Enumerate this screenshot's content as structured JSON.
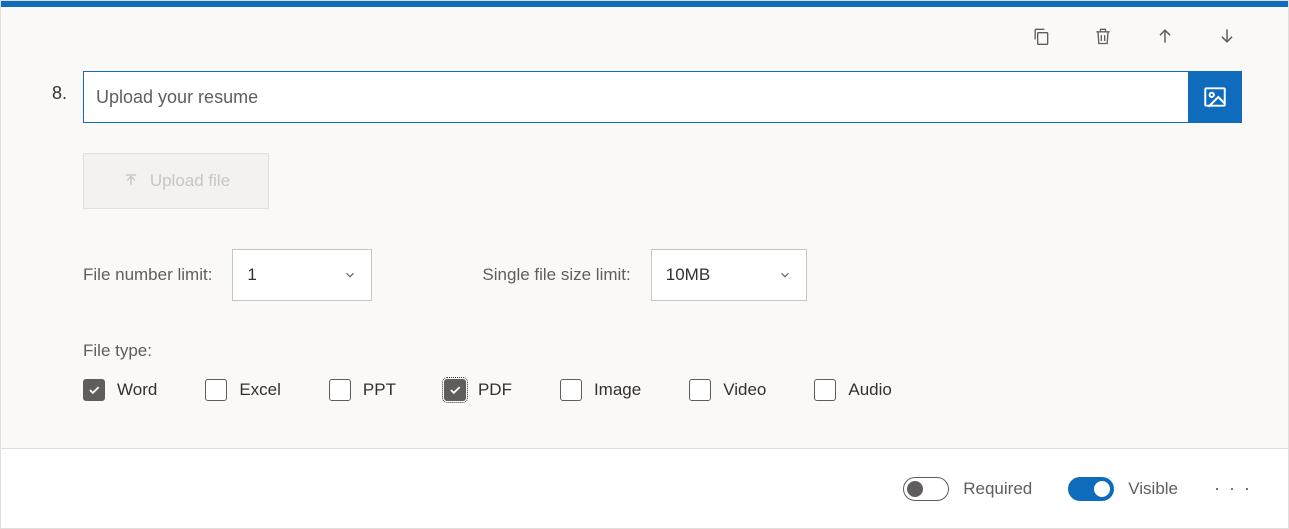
{
  "question": {
    "number": "8.",
    "title": "Upload your resume"
  },
  "upload_button_label": "Upload file",
  "file_number": {
    "label": "File number limit:",
    "value": "1"
  },
  "file_size": {
    "label": "Single file size limit:",
    "value": "10MB"
  },
  "file_type_label": "File type:",
  "file_types": {
    "word": {
      "label": "Word",
      "checked": true,
      "focused": false
    },
    "excel": {
      "label": "Excel",
      "checked": false,
      "focused": false
    },
    "ppt": {
      "label": "PPT",
      "checked": false,
      "focused": false
    },
    "pdf": {
      "label": "PDF",
      "checked": true,
      "focused": true
    },
    "image": {
      "label": "Image",
      "checked": false,
      "focused": false
    },
    "video": {
      "label": "Video",
      "checked": false,
      "focused": false
    },
    "audio": {
      "label": "Audio",
      "checked": false,
      "focused": false
    }
  },
  "footer": {
    "required": {
      "label": "Required",
      "on": false
    },
    "visible": {
      "label": "Visible",
      "on": true
    }
  }
}
